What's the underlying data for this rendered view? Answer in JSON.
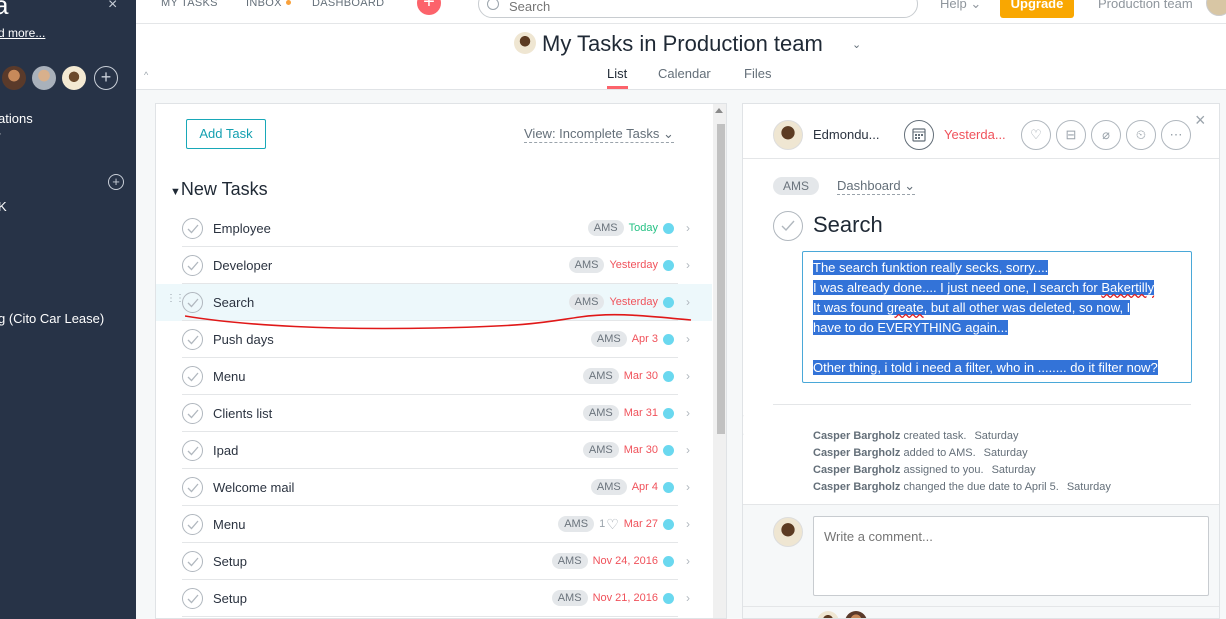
{
  "sidebar": {
    "logo": "a",
    "close": "×",
    "more": "d more...",
    "lines": [
      "ations",
      "K",
      "g (Cito Car Lease)"
    ]
  },
  "topbar": {
    "my_tasks": "MY TASKS",
    "inbox": "INBOX",
    "dashboard": "DASHBOARD",
    "search_placeholder": "Search",
    "help": "Help ⌄",
    "upgrade": "Upgrade",
    "team": "Production team"
  },
  "header": {
    "title": "My Tasks in Production team",
    "tabs": [
      "List",
      "Calendar",
      "Files"
    ],
    "active_tab": "List"
  },
  "list": {
    "add_task": "Add Task",
    "view_filter": "View: Incomplete Tasks ⌄",
    "section": "New Tasks",
    "tasks": [
      {
        "name": "Employee",
        "tag": "AMS",
        "due": "Today",
        "due_style": "today",
        "likes": ""
      },
      {
        "name": "Developer",
        "tag": "AMS",
        "due": "Yesterday",
        "due_style": "late",
        "likes": ""
      },
      {
        "name": "Search",
        "tag": "AMS",
        "due": "Yesterday",
        "due_style": "late",
        "likes": ""
      },
      {
        "name": "Push days",
        "tag": "AMS",
        "due": "Apr 3",
        "due_style": "late",
        "likes": ""
      },
      {
        "name": "Menu",
        "tag": "AMS",
        "due": "Mar 30",
        "due_style": "late",
        "likes": ""
      },
      {
        "name": "Clients list",
        "tag": "AMS",
        "due": "Mar 31",
        "due_style": "late",
        "likes": ""
      },
      {
        "name": "Ipad",
        "tag": "AMS",
        "due": "Mar 30",
        "due_style": "late",
        "likes": ""
      },
      {
        "name": "Welcome mail",
        "tag": "AMS",
        "due": "Apr 4",
        "due_style": "late",
        "likes": ""
      },
      {
        "name": "Menu",
        "tag": "AMS",
        "due": "Mar 27",
        "due_style": "late",
        "likes": "1"
      },
      {
        "name": "Setup",
        "tag": "AMS",
        "due": "Nov 24, 2016",
        "due_style": "late",
        "likes": ""
      },
      {
        "name": "Setup",
        "tag": "AMS",
        "due": "Nov 21, 2016",
        "due_style": "late",
        "likes": ""
      }
    ]
  },
  "detail": {
    "assignee": "Edmondu...",
    "due": "Yesterda...",
    "tag": "AMS",
    "project": "Dashboard ⌄",
    "title": "Search",
    "description": {
      "l1": "The search funktion really secks, sorry....",
      "l2a": "I was already done.... I just need one, I search for ",
      "l2b": "Bakertilly",
      "l3a": "It was found ",
      "l3b": "greate",
      "l3c": ", but all other was deleted, so now, I",
      "l4": "have to do EVERYTHING again...",
      "l5": "Other thing, i told i need a filter, who in ........ do it filter now?"
    },
    "stories": [
      {
        "author": "Casper Bargholz",
        "text": " created task.",
        "time": "Saturday"
      },
      {
        "author": "Casper Bargholz",
        "text": " added to AMS.",
        "time": "Saturday"
      },
      {
        "author": "Casper Bargholz",
        "text": " assigned to you.",
        "time": "Saturday"
      },
      {
        "author": "Casper Bargholz",
        "text": " changed the due date to April 5.",
        "time": "Saturday"
      }
    ],
    "comment_placeholder": "Write a comment..."
  }
}
